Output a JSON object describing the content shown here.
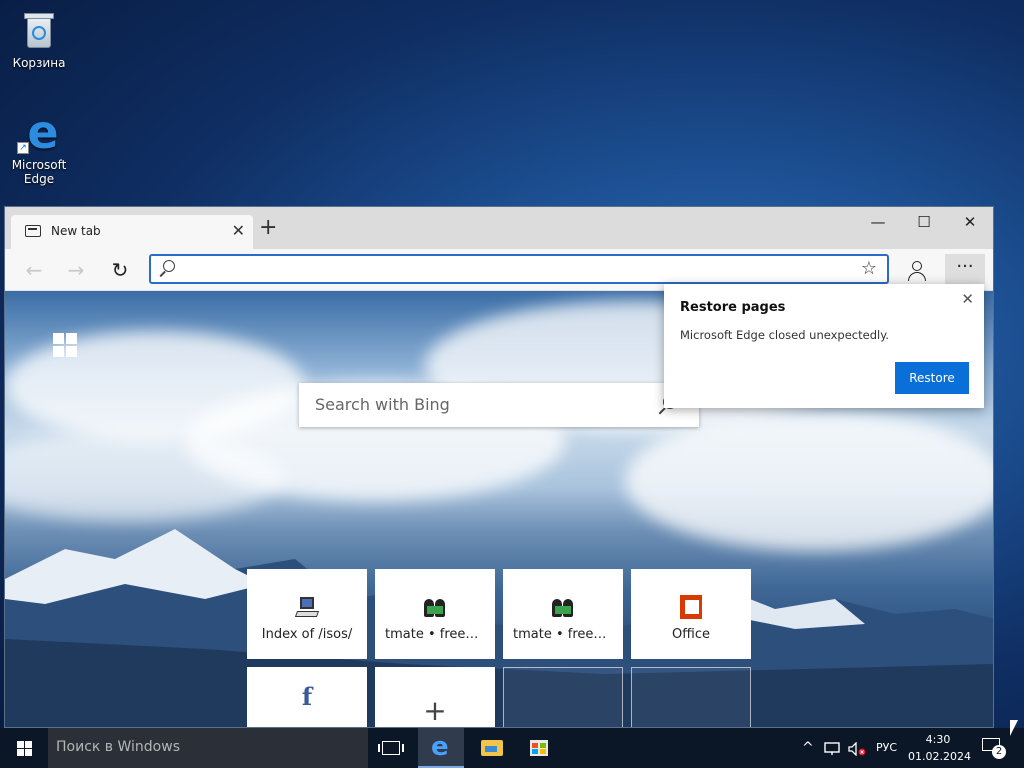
{
  "desktop": {
    "icons": [
      {
        "label": "Корзина",
        "icon": "recycle-bin-icon"
      },
      {
        "label": "Microsoft\nEdge",
        "icon": "edge-icon"
      }
    ]
  },
  "browser": {
    "tab": {
      "title": "New tab",
      "icon": "newtab-page-icon",
      "close": "✕"
    },
    "new_tab": "+",
    "window_controls": {
      "minimize": "—",
      "maximize": "☐",
      "close": "✕"
    },
    "nav": {
      "back": "←",
      "forward": "→",
      "refresh": "↻"
    },
    "address": {
      "value": "",
      "favorite": "☆"
    },
    "more": "···",
    "newtab_page": {
      "search_placeholder": "Search with Bing",
      "tiles": [
        {
          "label": "Index of /isos/",
          "icon": "monitor-icon"
        },
        {
          "label": "tmate • freevm…",
          "icon": "people-icon"
        },
        {
          "label": "tmate • freevm…",
          "icon": "people-icon"
        },
        {
          "label": "Office",
          "icon": "office-icon"
        },
        {
          "label": "",
          "icon": "facebook-icon",
          "glyph": "f"
        },
        {
          "label": "",
          "icon": "plus-icon",
          "glyph": "+"
        }
      ]
    },
    "restore_popup": {
      "title": "Restore pages",
      "message": "Microsoft Edge closed unexpectedly.",
      "button": "Restore",
      "close": "✕"
    }
  },
  "taskbar": {
    "search_placeholder": "Поиск в Windows",
    "tray": {
      "chevron": "^",
      "language": "РУС"
    },
    "clock": {
      "time": "4:30",
      "date": "01.02.2024"
    },
    "notifications": "2"
  },
  "colors": {
    "accent": "#0a6fd8",
    "taskbar": "#0b1626",
    "office": "#d83b01",
    "facebook": "#3b5998"
  }
}
